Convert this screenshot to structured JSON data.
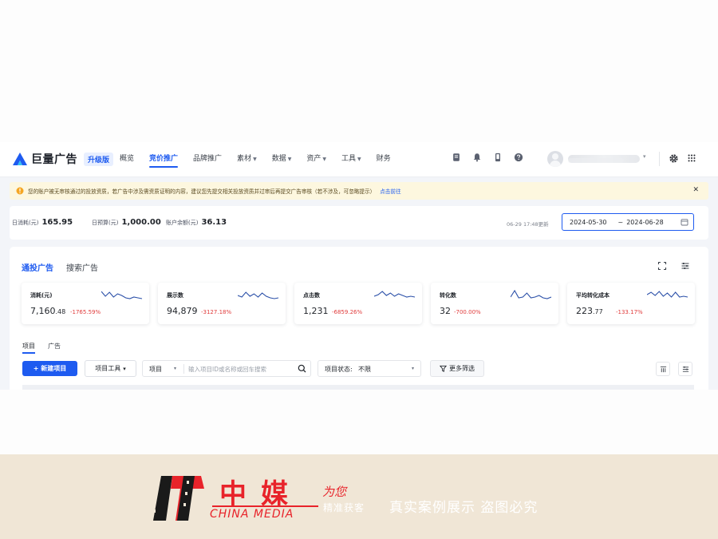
{
  "app": {
    "name": "巨量广告",
    "badge": "升级版"
  },
  "nav": {
    "items": [
      {
        "label": "概览",
        "active": false,
        "dropdown": false
      },
      {
        "label": "竞价推广",
        "active": true,
        "dropdown": false
      },
      {
        "label": "品牌推广",
        "active": false,
        "dropdown": false
      },
      {
        "label": "素材",
        "active": false,
        "dropdown": true
      },
      {
        "label": "数据",
        "active": false,
        "dropdown": true
      },
      {
        "label": "资产",
        "active": false,
        "dropdown": true
      },
      {
        "label": "工具",
        "active": false,
        "dropdown": true
      },
      {
        "label": "财务",
        "active": false,
        "dropdown": false
      }
    ],
    "icons": [
      "document-icon",
      "bell-icon",
      "phone-icon",
      "help-icon"
    ],
    "right_icons": [
      "gear-icon",
      "grid-icon"
    ]
  },
  "notice": {
    "text": "您的账户被无审核通过的投放资质，若广告中涉及需资质证明的内容，建议您先提交相关投放资质并过审后再提交广告审核（若不涉及，可忽略提示）",
    "link": "点击前往",
    "accent": "#fdf7df"
  },
  "budget": {
    "items": [
      {
        "label": "日消耗(元)",
        "value": "165.95"
      },
      {
        "label": "日预算(元)",
        "value": "1,000.00"
      },
      {
        "label": "账户余额(元)",
        "value": "36.13"
      }
    ],
    "updated": "06-29 17:48更新",
    "date_start": "2024-05-30",
    "date_sep": "~",
    "date_end": "2024-06-28"
  },
  "main": {
    "tabs": [
      "通投广告",
      "搜索广告"
    ],
    "metrics": [
      {
        "label": "消耗(元)",
        "value_int": "7,160",
        "value_dec": ".48",
        "change": "-1765.59%"
      },
      {
        "label": "展示数",
        "value_int": "94,879",
        "value_dec": "",
        "change": "-3127.18%"
      },
      {
        "label": "点击数",
        "value_int": "1,231",
        "value_dec": "",
        "change": "-6859.26%"
      },
      {
        "label": "转化数",
        "value_int": "32",
        "value_dec": "",
        "change": "-700.00%"
      },
      {
        "label": "平均转化成本",
        "value_int": "223",
        "value_dec": ".77",
        "change": "-133.17%"
      }
    ],
    "subtabs": [
      "项目",
      "广告"
    ],
    "toolbar": {
      "new_label": "+ 新建项目",
      "tool_label": "项目工具",
      "search_scope": "项目",
      "search_placeholder": "输入项目ID或名称或回车搜索",
      "status_label": "项目状态:",
      "status_value": "不限",
      "filter_label": "更多筛选"
    }
  },
  "colors": {
    "primary": "#1e5bf0",
    "negative": "#e03c3c",
    "spark": "#2a4fa8",
    "watermark_red": "#e8232a"
  },
  "watermark": {
    "brand_cn": "中媒",
    "brand_en": "CHINA MEDIA",
    "tag1": "为您",
    "tag2": "精准获客",
    "claim": "真实案例展示  盗图必究"
  }
}
